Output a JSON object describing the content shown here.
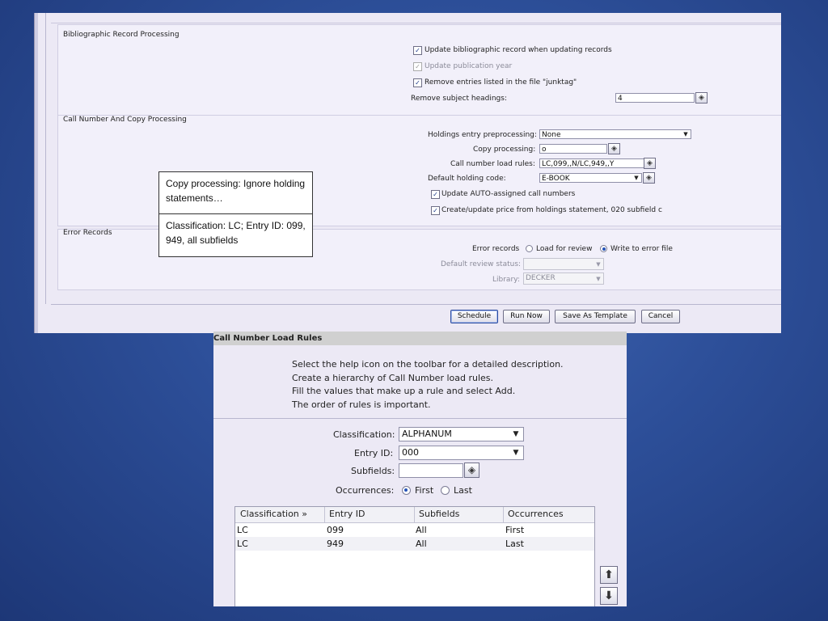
{
  "bib": {
    "section_title": "Bibliographic Record Processing",
    "update_bib_label": "Update bibliographic record when updating records",
    "update_pub_year_label": "Update publication year",
    "remove_junktag_label": "Remove entries listed in the file \"junktag\"",
    "remove_subject_label": "Remove subject headings:",
    "remove_subject_value": "4"
  },
  "callno": {
    "section_title": "Call Number And Copy Processing",
    "holdings_label": "Holdings entry preprocessing:",
    "holdings_value": "None",
    "copy_label": "Copy processing:",
    "copy_value": "o",
    "rules_label": "Call number load rules:",
    "rules_value": "LC,099,,N/LC,949,,Y",
    "default_holding_label": "Default holding code:",
    "default_holding_value": "E-BOOK",
    "update_auto_label": "Update AUTO-assigned call numbers",
    "price_label": "Create/update price from holdings statement, 020 subfield c"
  },
  "errors": {
    "section_title": "Error Records",
    "error_records_label": "Error records",
    "load_review_label": "Load for review",
    "write_error_label": "Write to error file",
    "default_review_label": "Default review status:",
    "default_review_value": "",
    "library_label": "Library:",
    "library_value": "DECKER"
  },
  "buttons": {
    "schedule": "Schedule",
    "run_now": "Run Now",
    "save_template": "Save As Template",
    "cancel": "Cancel"
  },
  "callouts": {
    "copy": "Copy processing: Ignore holding statements…",
    "classification": "Classification: LC; Entry ID: 099, 949, all subfields"
  },
  "load_rules": {
    "title": "Call Number Load Rules",
    "instructions": [
      "Select the help icon on the toolbar for a detailed description.",
      "Create a hierarchy of Call Number load rules.",
      "Fill the values that make up a rule and select Add.",
      "The order of rules is important."
    ],
    "classification_label": "Classification:",
    "classification_value": "ALPHANUM",
    "entry_id_label": "Entry ID:",
    "entry_id_value": "000",
    "subfields_label": "Subfields:",
    "subfields_value": "",
    "occurrences_label": "Occurrences:",
    "first_label": "First",
    "last_label": "Last",
    "table": {
      "headers": [
        "Classification »",
        "Entry ID",
        "Subfields",
        "Occurrences"
      ],
      "rows": [
        [
          "LC",
          "099",
          "All",
          "First"
        ],
        [
          "LC",
          "949",
          "All",
          "Last"
        ]
      ]
    }
  },
  "icons": {
    "help": "help-diamond-icon",
    "dropdown": "chevron-down-icon",
    "move_up": "arrow-up-icon",
    "move_down": "arrow-down-icon"
  }
}
